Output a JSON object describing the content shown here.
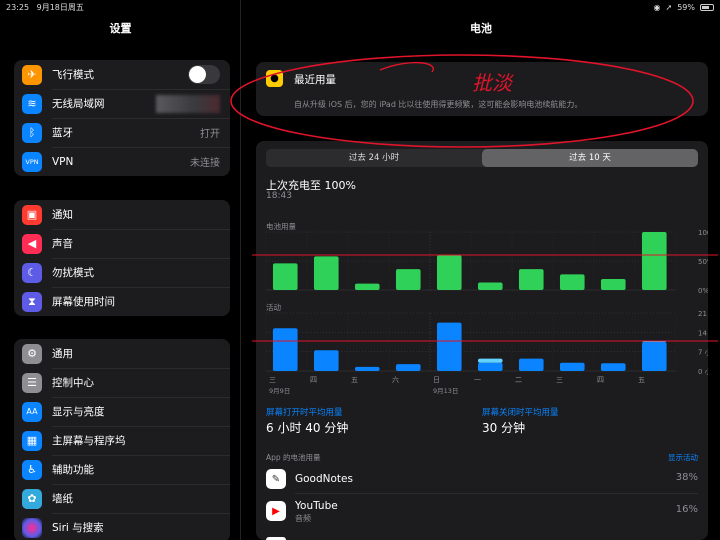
{
  "status": {
    "time": "23:25",
    "date": "9月18日周五",
    "battery": "59%"
  },
  "sidebar": {
    "title": "设置",
    "group1": [
      {
        "label": "飞行模式",
        "icon": "airplane-icon",
        "color": "#ff9500",
        "control": "toggle"
      },
      {
        "label": "无线局域网",
        "icon": "wifi-icon",
        "color": "#0a84ff",
        "control": "blurred"
      },
      {
        "label": "蓝牙",
        "icon": "bluetooth-icon",
        "color": "#0a84ff",
        "value": "打开"
      },
      {
        "label": "VPN",
        "icon": "vpn-icon",
        "color": "#0a84ff",
        "value": "未连接"
      }
    ],
    "group2": [
      {
        "label": "通知",
        "icon": "notification-icon",
        "color": "#ff3b30"
      },
      {
        "label": "声音",
        "icon": "sound-icon",
        "color": "#ff2d55"
      },
      {
        "label": "勿扰模式",
        "icon": "moon-icon",
        "color": "#5e5ce6"
      },
      {
        "label": "屏幕使用时间",
        "icon": "hourglass-icon",
        "color": "#5e5ce6"
      }
    ],
    "group3": [
      {
        "label": "通用",
        "icon": "gear-icon",
        "color": "#8e8e93"
      },
      {
        "label": "控制中心",
        "icon": "switches-icon",
        "color": "#8e8e93"
      },
      {
        "label": "显示与亮度",
        "icon": "text-size-icon",
        "color": "#0a84ff"
      },
      {
        "label": "主屏幕与程序坞",
        "icon": "grid-icon",
        "color": "#0a84ff"
      },
      {
        "label": "辅助功能",
        "icon": "accessibility-icon",
        "color": "#0a84ff"
      },
      {
        "label": "墙纸",
        "icon": "flower-icon",
        "color": "#34aadc"
      },
      {
        "label": "Siri 与搜索",
        "icon": "siri-icon",
        "color": "#222"
      }
    ]
  },
  "pane": {
    "title": "电池",
    "recent": {
      "title": "最近用量",
      "desc": "自从升级 iOS 后，您的 iPad 比以往使用得更频繁，这可能会影响电池续航能力。"
    },
    "segments": [
      {
        "label": "过去 24 小时",
        "active": false
      },
      {
        "label": "过去 10 天",
        "active": true
      }
    ],
    "last_charge": "上次充电至 100%",
    "last_charge_time": "18:43",
    "battery_label": "电池用量",
    "activity_label": "活动",
    "screen_on_label": "屏幕打开时平均用量",
    "screen_on_value": "6 小时 40 分钟",
    "screen_off_label": "屏幕关闭时平均用量",
    "screen_off_value": "30 分钟",
    "apps_head": "App 的电池用量",
    "show_activity": "显示活动",
    "apps": [
      {
        "name": "GoodNotes",
        "sub": "",
        "pct": "38%",
        "icon": "goodnotes-icon",
        "color": "#ffffff"
      },
      {
        "name": "YouTube",
        "sub": "音频",
        "pct": "16%",
        "icon": "youtube-icon",
        "color": "#ffffff"
      }
    ],
    "annotation_text": "批淡"
  },
  "chart_data": [
    {
      "type": "bar",
      "title": "电池用量",
      "categories": [
        "三",
        "四",
        "五",
        "六",
        "日",
        "一",
        "二",
        "三",
        "四",
        "五"
      ],
      "date_labels": [
        "9月9日",
        "9月13日"
      ],
      "values": [
        46,
        58,
        11,
        36,
        60,
        13,
        36,
        27,
        19,
        100
      ],
      "yticks": [
        "100%",
        "50%",
        "0%"
      ],
      "ylim": [
        0,
        100
      ],
      "color": "#30d158"
    },
    {
      "type": "bar",
      "title": "活动",
      "categories": [
        "三",
        "四",
        "五",
        "六",
        "日",
        "一",
        "二",
        "三",
        "四",
        "五"
      ],
      "values": [
        15.5,
        7.5,
        1.5,
        2.5,
        17.5,
        3.0,
        4.5,
        3.0,
        2.8,
        10.5
      ],
      "values_secondary": [
        0,
        0,
        0,
        0,
        0,
        1.5,
        0,
        0,
        0,
        0.5
      ],
      "yticks": [
        "21 小时",
        "14 小时",
        "7 小时",
        "0 小时"
      ],
      "ylim": [
        0,
        21
      ],
      "color": "#0a84ff"
    }
  ]
}
